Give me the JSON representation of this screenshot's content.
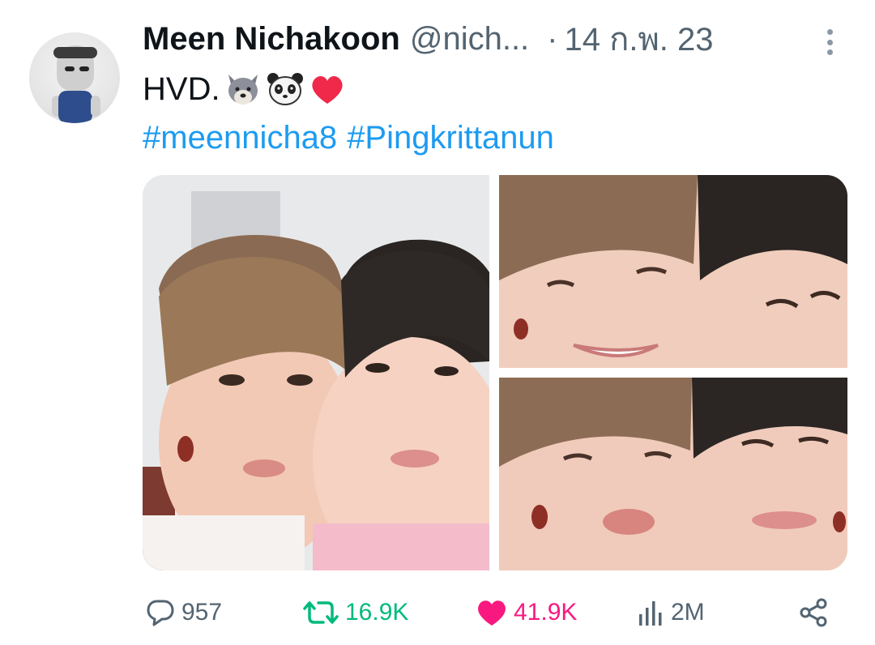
{
  "author": {
    "name": "Meen Nichakoon",
    "handle": "@nich...",
    "separator": "·",
    "date": "14 ก.พ. 23"
  },
  "tweet": {
    "text": "HVD.",
    "emojis": [
      "wolf-emoji",
      "panda-emoji",
      "red-heart-emoji"
    ],
    "hashtags": [
      "#meennicha8",
      "#Pingkrittanun"
    ]
  },
  "media": {
    "count": 3
  },
  "actions": {
    "reply_count": "957",
    "retweet_count": "16.9K",
    "like_count": "41.9K",
    "views_count": "2M"
  },
  "colors": {
    "text": "#0f1419",
    "secondary": "#536471",
    "link": "#1d9bf0",
    "retweet": "#00ba7c",
    "like": "#f91880"
  },
  "icons": {
    "reply": "reply-bubble-icon",
    "retweet": "retweet-icon",
    "like": "heart-icon",
    "views": "bar-chart-icon",
    "share": "share-icon",
    "more": "more-vertical-icon"
  }
}
